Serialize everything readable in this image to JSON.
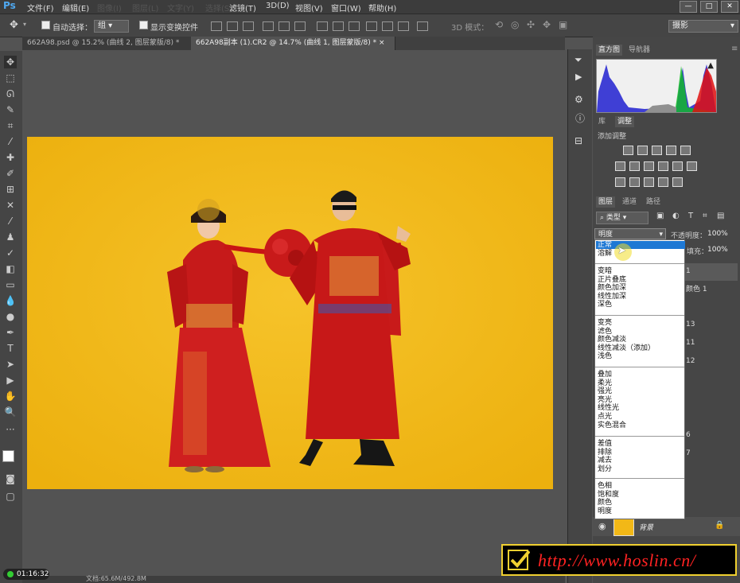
{
  "app": {
    "logo": "Ps"
  },
  "menubar": {
    "items": [
      "文件(F)",
      "编辑(E)",
      "图像(I)",
      "图层(L)",
      "文字(Y)",
      "选择(S)",
      "滤镜(T)",
      "3D(D)",
      "视图(V)",
      "窗口(W)",
      "帮助(H)"
    ],
    "window_controls": [
      "—",
      "□",
      "✕"
    ]
  },
  "options_bar": {
    "auto_select_label": "自动选择：",
    "auto_select_value": "组",
    "show_transform_label": "显示变换控件",
    "mode_3d_label": "3D 模式：",
    "workspace": "摄影"
  },
  "tabs": [
    {
      "label": "662A98.psd @ 15.2% (曲线 2, 图层蒙版/8) *",
      "active": false
    },
    {
      "label": "662A98副本 (1).CR2 @ 14.7% (曲线 1, 图层蒙版/8) *",
      "active": true
    }
  ],
  "panels": {
    "histogram_tab": "直方图",
    "navigator_tab": "导航器",
    "library_tab": "库",
    "adjustments_tab": "调整",
    "add_adjustment_label": "添加调整",
    "layers_tab": "图层",
    "channels_tab": "通道",
    "paths_tab": "路径",
    "kind_filter": "类型",
    "opacity_label": "不透明度：",
    "opacity_value": "100%",
    "fill_label": "填充：",
    "fill_value": "100%",
    "background_layer_name": "背景",
    "layer_numbers": [
      "1",
      "颜色 1",
      "13",
      "11",
      "12",
      "6",
      "7"
    ]
  },
  "blend_mode": {
    "current": "明度",
    "groups": [
      [
        "正常",
        "溶解"
      ],
      [
        "变暗",
        "正片叠底",
        "颜色加深",
        "线性加深",
        "深色"
      ],
      [
        "变亮",
        "滤色",
        "颜色减淡",
        "线性减淡（添加）",
        "浅色"
      ],
      [
        "叠加",
        "柔光",
        "强光",
        "亮光",
        "线性光",
        "点光",
        "实色混合"
      ],
      [
        "差值",
        "排除",
        "减去",
        "划分"
      ],
      [
        "色相",
        "饱和度",
        "颜色",
        "明度"
      ]
    ],
    "highlighted": "正常"
  },
  "status": {
    "doc_size": "文档:65.6M/492.8M"
  },
  "timer": "01:16:32",
  "watermark": {
    "url": "http://www.hoslin.cn/"
  },
  "colors": {
    "photo_background": "#f2b817",
    "highlight": "#1e78d4",
    "watermark_text": "#ff2222"
  }
}
